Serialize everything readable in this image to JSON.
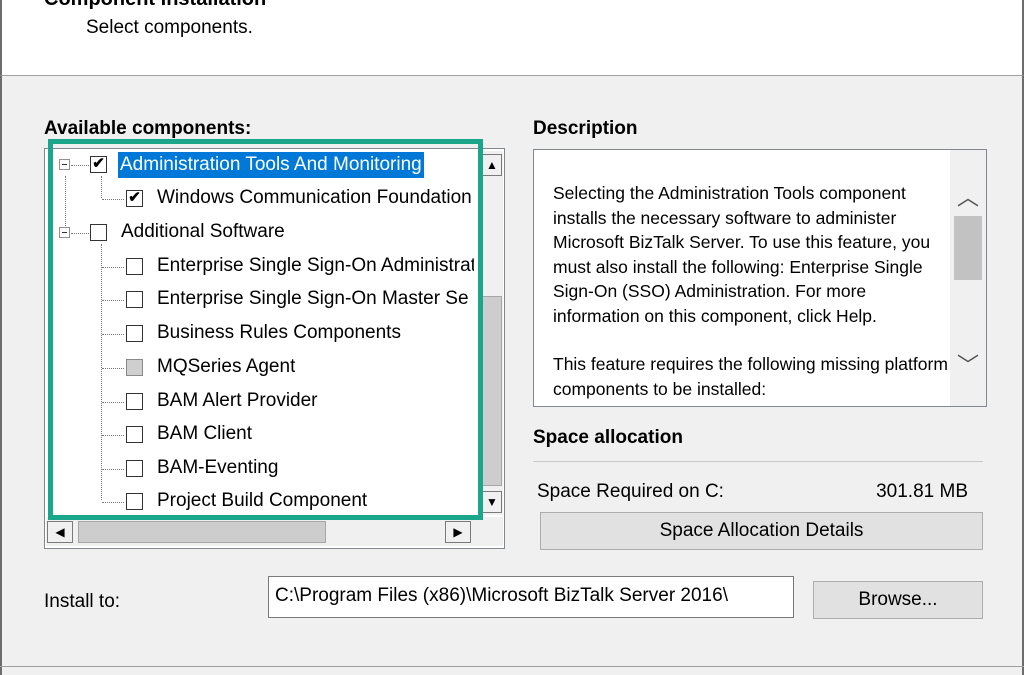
{
  "header": {
    "title": "Component Installation",
    "subtitle": "Select components."
  },
  "components": {
    "label": "Available components:",
    "items": [
      {
        "label": "Administration Tools And Monitoring",
        "checked": true,
        "level": 0,
        "selected": true
      },
      {
        "label": "Windows Communication Foundation",
        "checked": true,
        "level": 1
      },
      {
        "label": "Additional Software",
        "checked": false,
        "level": 0
      },
      {
        "label": "Enterprise Single Sign-On Administration",
        "checked": false,
        "level": 1
      },
      {
        "label": "Enterprise Single Sign-On Master Se",
        "checked": false,
        "level": 1
      },
      {
        "label": "Business Rules Components",
        "checked": false,
        "level": 1
      },
      {
        "label": "MQSeries Agent",
        "checked": false,
        "level": 1,
        "disabled": true
      },
      {
        "label": "BAM Alert Provider",
        "checked": false,
        "level": 1
      },
      {
        "label": "BAM Client",
        "checked": false,
        "level": 1
      },
      {
        "label": "BAM-Eventing",
        "checked": false,
        "level": 1
      },
      {
        "label": "Project Build Component",
        "checked": false,
        "level": 1
      }
    ],
    "check_glyph": "✔"
  },
  "description": {
    "label": "Description",
    "paragraph1": "Selecting the Administration Tools component installs the necessary software to administer Microsoft BizTalk Server. To use this feature, you must also install the following: Enterprise Single Sign-On (SSO) Administration. For more information on this component, click Help.",
    "paragraph2": "This feature requires the following missing platform components to be installed:"
  },
  "space": {
    "label": "Space allocation",
    "required_label": "Space Required on C:",
    "required_value": "301.81 MB",
    "details_button": "Space Allocation Details"
  },
  "install": {
    "label": "Install to:",
    "path": "C:\\Program Files (x86)\\Microsoft BizTalk Server 2016\\",
    "browse_button": "Browse..."
  },
  "colors": {
    "highlight": "#1aa68a",
    "selection": "#0078d7"
  }
}
